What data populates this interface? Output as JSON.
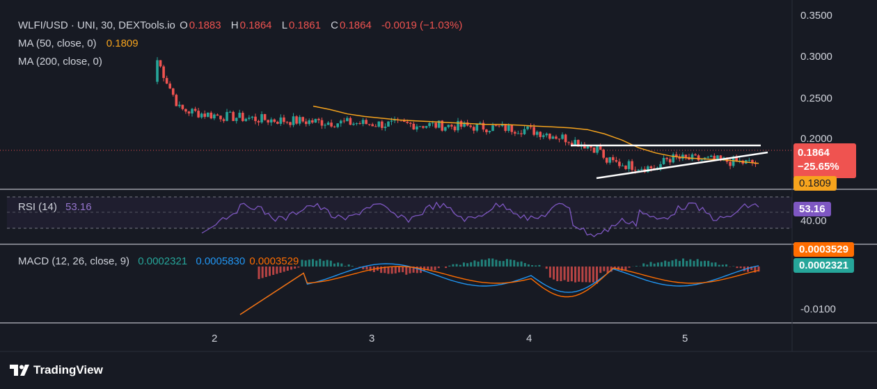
{
  "theme": {
    "bg": "#171a23",
    "up": "#26a69a",
    "down": "#ef5350",
    "ma50": "#f7a41d",
    "rsi": "#7e57c2",
    "macd": "#2196f3",
    "signal": "#ff6d00"
  },
  "header": {
    "symbol": "WLFI/USD · UNI, 30, DEXTools.io",
    "o_label": "O",
    "o_value": "0.1883",
    "h_label": "H",
    "h_value": "0.1864",
    "l_label": "L",
    "l_value": "0.1861",
    "c_label": "C",
    "c_value": "0.1864",
    "change": "-0.0019 (−1.03%)"
  },
  "ma50": {
    "label": "MA (50, close, 0)",
    "value": "0.1809"
  },
  "ma200": {
    "label": "MA (200, close, 0)"
  },
  "price_axis": {
    "ticks": [
      "0.3500",
      "0.3000",
      "0.2500",
      "0.2000"
    ],
    "last_price": "0.1864",
    "last_change": "−25.65%",
    "ma_value": "0.1809"
  },
  "rsi": {
    "label": "RSI (14)",
    "value": "53.16",
    "tick": "40.00",
    "axis_value": "53.16"
  },
  "macd": {
    "label": "MACD (12, 26, close, 9)",
    "hist": "0.0002321",
    "macd": "0.0005830",
    "signal": "0.0003529",
    "axis_signal": "0.0003529",
    "axis_hist": "0.0002321",
    "tick": "-0.0100"
  },
  "time_axis": {
    "ticks": [
      "2",
      "3",
      "4",
      "5"
    ]
  },
  "brand": {
    "name": "TradingView"
  },
  "chart_data": {
    "type": "candlestick",
    "ylim": [
      0.16,
      0.35
    ],
    "series": [
      {
        "name": "MA (50, close, 0)",
        "values": [
          0.247,
          0.243,
          0.238,
          0.235,
          0.233,
          0.231,
          0.23,
          0.229,
          0.228,
          0.227,
          0.226,
          0.226,
          0.225,
          0.224,
          0.223,
          0.222,
          0.22,
          0.215,
          0.208,
          0.199,
          0.193,
          0.189,
          0.187,
          0.186,
          0.185,
          0.183,
          0.181
        ]
      }
    ],
    "x": [
      "2",
      "3",
      "4",
      "5"
    ]
  }
}
